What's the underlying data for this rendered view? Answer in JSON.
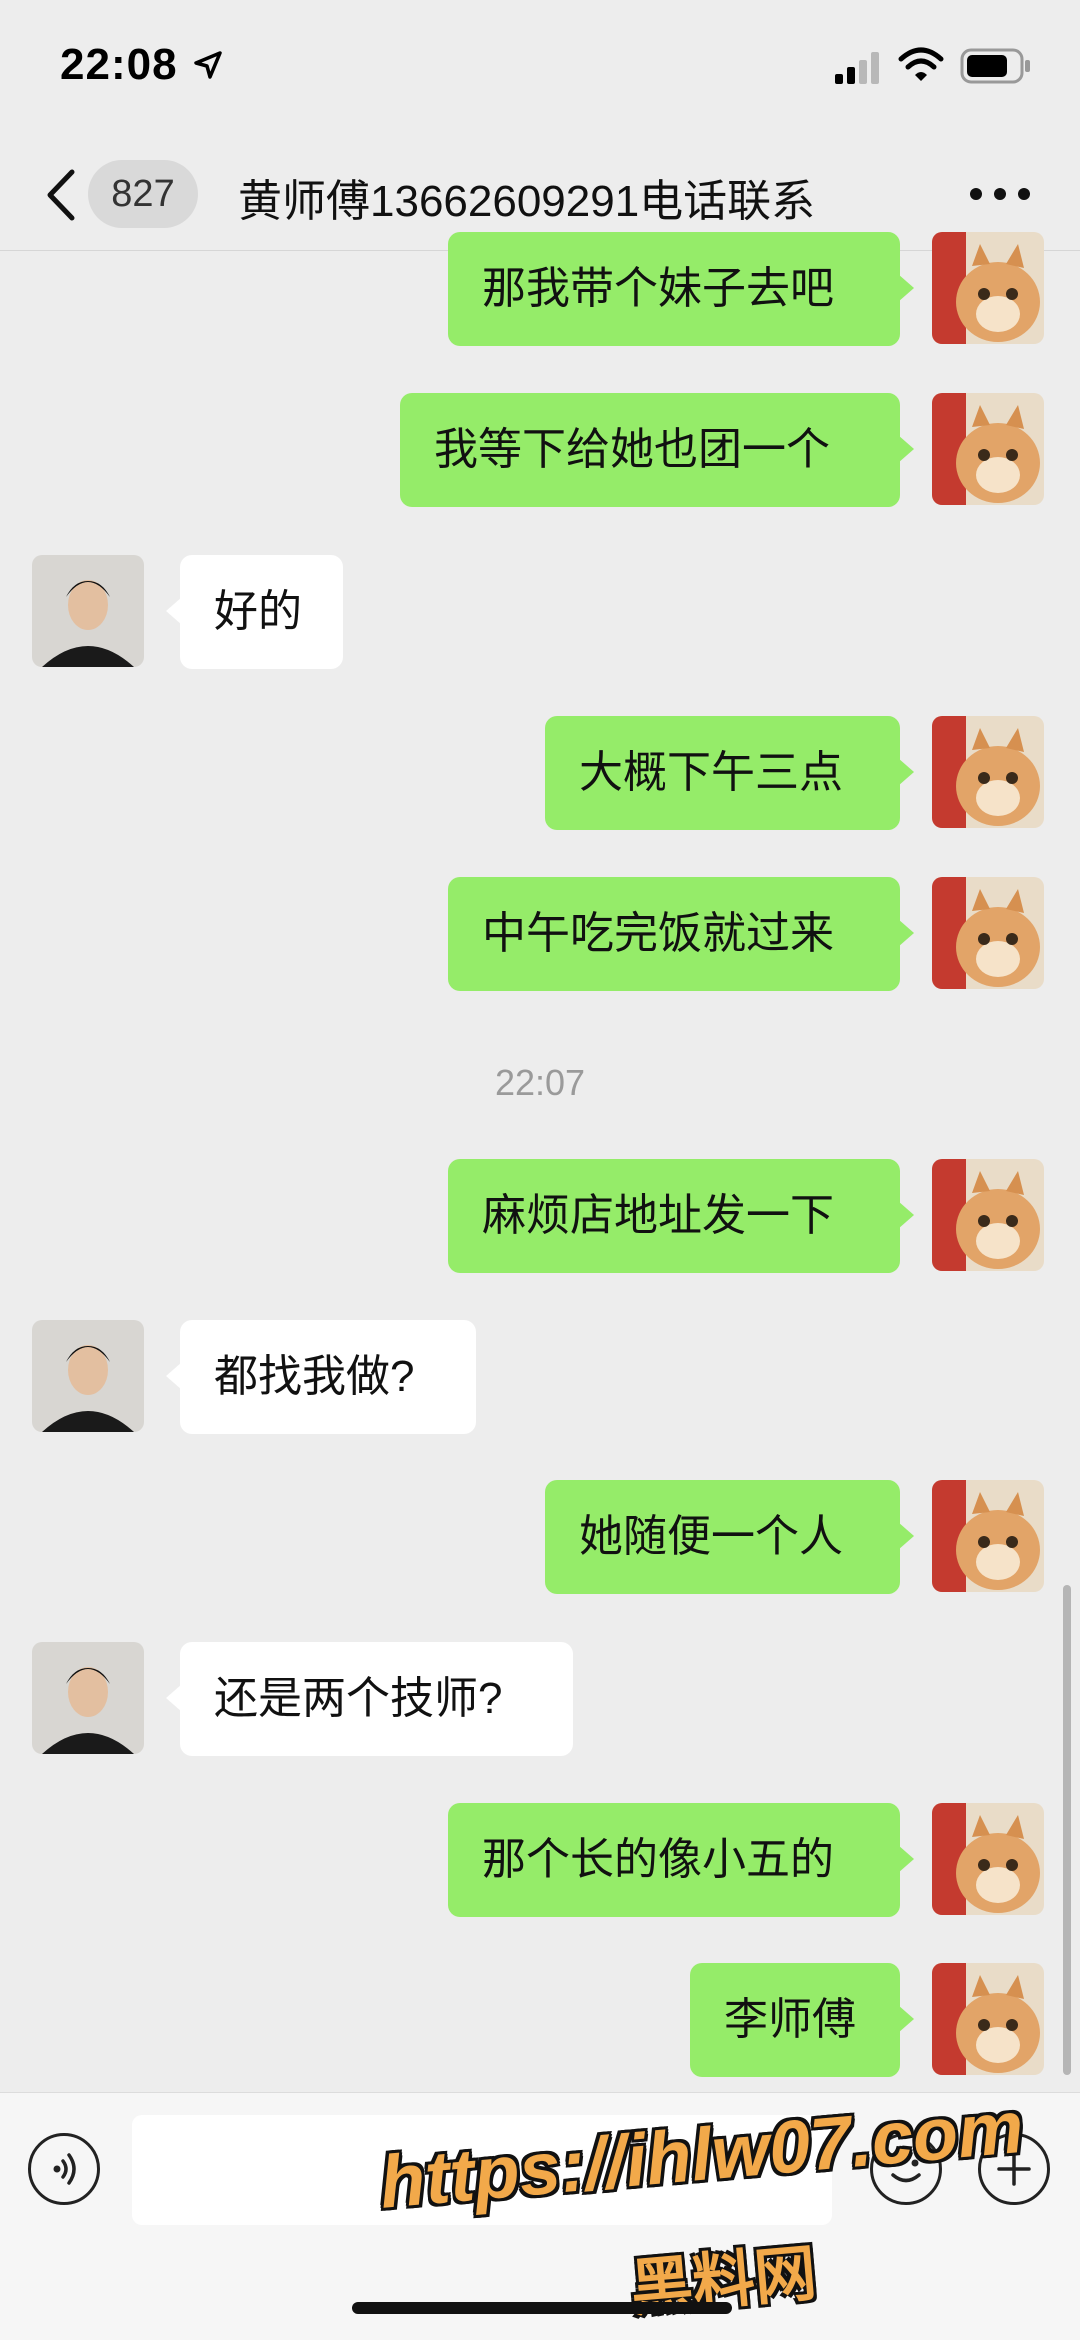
{
  "status_bar": {
    "time": "22:08"
  },
  "nav": {
    "unread_count": "827",
    "title": "黄师傅13662609291电话联系"
  },
  "messages": [
    {
      "from": "me",
      "text": "那我带个妹子去吧"
    },
    {
      "from": "me",
      "text": "我等下给她也团一个"
    },
    {
      "from": "contact",
      "text": "好的"
    },
    {
      "from": "me",
      "text": "大概下午三点"
    },
    {
      "from": "me",
      "text": "中午吃完饭就过来"
    },
    {
      "from": "me",
      "text": "麻烦店地址发一下"
    },
    {
      "from": "contact",
      "text": "都找我做?"
    },
    {
      "from": "me",
      "text": "她随便一个人"
    },
    {
      "from": "contact",
      "text": "还是两个技师?"
    },
    {
      "from": "me",
      "text": "那个长的像小五的"
    },
    {
      "from": "me",
      "text": "李师傅"
    }
  ],
  "timestamp": "22:07",
  "watermark": {
    "url": "https://ihlw07.com",
    "label": "黑料网"
  },
  "colors": {
    "outgoing_bubble": "#95ec69",
    "incoming_bubble": "#ffffff",
    "background": "#ededed"
  },
  "icons": [
    "location-arrow-icon",
    "signal-icon",
    "wifi-icon",
    "battery-icon",
    "back-chevron-icon",
    "more-icon",
    "voice-icon",
    "emoji-icon",
    "plus-icon"
  ]
}
